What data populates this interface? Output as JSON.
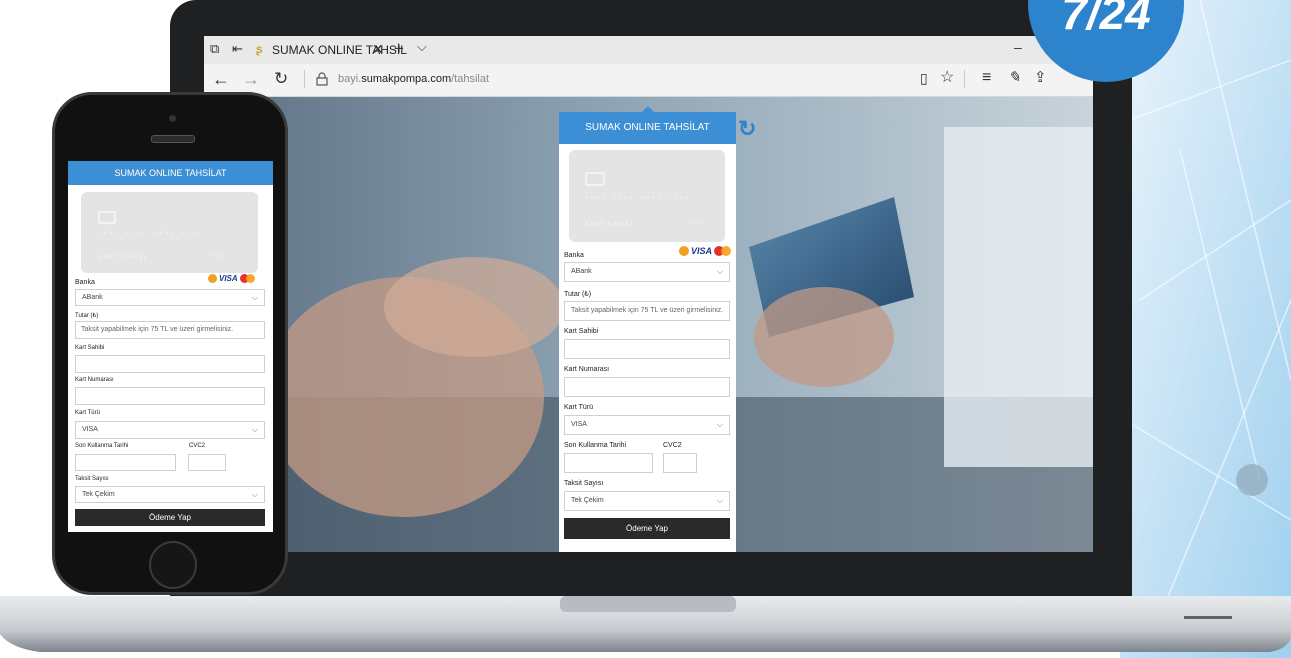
{
  "badge": {
    "text": "7/24"
  },
  "browser": {
    "tab_title": "SUMAK ONLINE TAHSİL",
    "url_domain": "bayi.sumakpompa.com",
    "url_host_prefix": "bayi.",
    "url_host_main": "sumakpompa.com",
    "url_path": "/tahsilat"
  },
  "form": {
    "title": "SUMAK ONLINE TAHSİLAT",
    "card_number": "**** **** **** ****",
    "card_holder": "KART SAHİBİ",
    "card_expiry": "**/**",
    "bank_label": "Banka",
    "bank_value": "ABank",
    "amount_label": "Tutar (₺)",
    "amount_placeholder": "Taksit yapabilmek için 75 TL ve üzeri girmelisiniz.",
    "holder_label": "Kart Sahibi",
    "number_label": "Kart Numarası",
    "type_label": "Kart Türü",
    "type_value": "VISA",
    "expiry_label": "Son Kullanma Tarihi",
    "cvc_label": "CVC2",
    "installment_label": "Taksit Sayısı",
    "installment_value": "Tek Çekim",
    "submit_label": "Ödeme Yap",
    "brand_visa": "VISA"
  },
  "colors": {
    "accent": "#3d8fd5",
    "badge": "#2d84cc",
    "button": "#2a2a2a"
  },
  "icons": [
    "tab-preview-icon",
    "tab-back-icon",
    "site-favicon",
    "close-tab-icon",
    "new-tab-icon",
    "tab-list-icon",
    "back-icon",
    "forward-icon",
    "refresh-icon",
    "lock-icon",
    "reading-view-icon",
    "favorite-star-icon",
    "hub-icon",
    "notes-icon",
    "share-icon",
    "chevron-down-icon",
    "refresh-arrow-icon",
    "card-chip-icon",
    "troy-logo-icon",
    "visa-logo-icon",
    "mastercard-logo-icon"
  ]
}
